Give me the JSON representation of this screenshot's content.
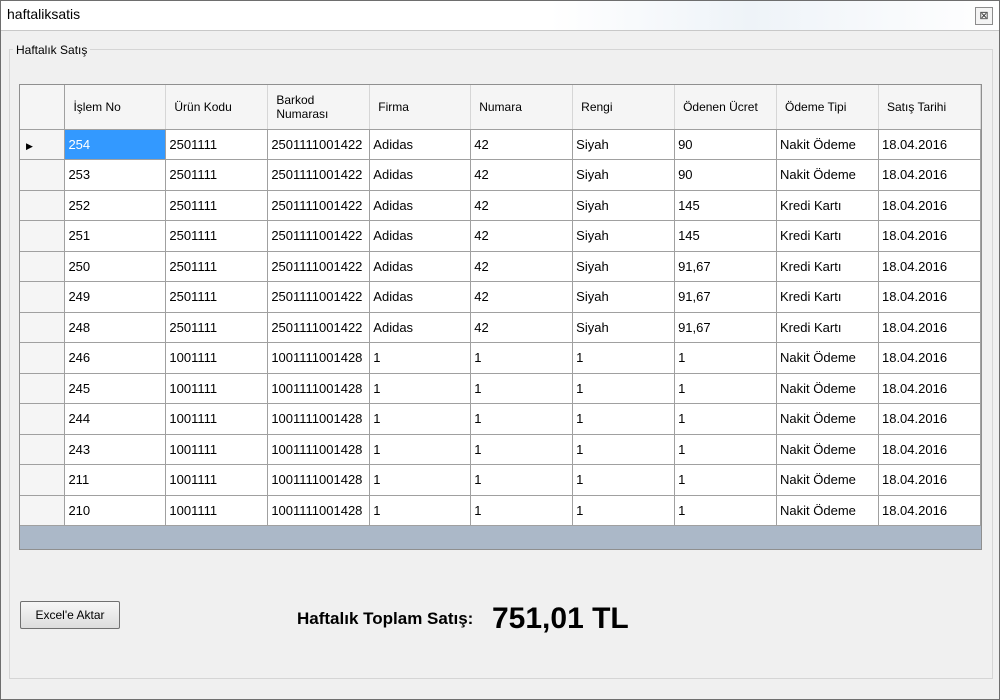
{
  "window": {
    "title": "haftaliksatis",
    "close_glyph": "⊠"
  },
  "group": {
    "title": "Haftalık Satış"
  },
  "grid": {
    "columns": [
      "İşlem No",
      "Ürün Kodu",
      "Barkod Numarası",
      "Firma",
      "Numara",
      "Rengi",
      "Ödenen Ücret",
      "Ödeme Tipi",
      "Satış Tarihi"
    ],
    "current_row_glyph": "▶",
    "selected_row": 0,
    "selected_col": 0,
    "rows": [
      [
        "254",
        "2501111",
        "2501111001422",
        "Adidas",
        "42",
        "Siyah",
        "90",
        "Nakit Ödeme",
        "18.04.2016"
      ],
      [
        "253",
        "2501111",
        "2501111001422",
        "Adidas",
        "42",
        "Siyah",
        "90",
        "Nakit Ödeme",
        "18.04.2016"
      ],
      [
        "252",
        "2501111",
        "2501111001422",
        "Adidas",
        "42",
        "Siyah",
        "145",
        "Kredi Kartı",
        "18.04.2016"
      ],
      [
        "251",
        "2501111",
        "2501111001422",
        "Adidas",
        "42",
        "Siyah",
        "145",
        "Kredi Kartı",
        "18.04.2016"
      ],
      [
        "250",
        "2501111",
        "2501111001422",
        "Adidas",
        "42",
        "Siyah",
        "91,67",
        "Kredi Kartı",
        "18.04.2016"
      ],
      [
        "249",
        "2501111",
        "2501111001422",
        "Adidas",
        "42",
        "Siyah",
        "91,67",
        "Kredi Kartı",
        "18.04.2016"
      ],
      [
        "248",
        "2501111",
        "2501111001422",
        "Adidas",
        "42",
        "Siyah",
        "91,67",
        "Kredi Kartı",
        "18.04.2016"
      ],
      [
        "246",
        "1001111",
        "1001111001428",
        "1",
        "1",
        "1",
        "1",
        "Nakit Ödeme",
        "18.04.2016"
      ],
      [
        "245",
        "1001111",
        "1001111001428",
        "1",
        "1",
        "1",
        "1",
        "Nakit Ödeme",
        "18.04.2016"
      ],
      [
        "244",
        "1001111",
        "1001111001428",
        "1",
        "1",
        "1",
        "1",
        "Nakit Ödeme",
        "18.04.2016"
      ],
      [
        "243",
        "1001111",
        "1001111001428",
        "1",
        "1",
        "1",
        "1",
        "Nakit Ödeme",
        "18.04.2016"
      ],
      [
        "211",
        "1001111",
        "1001111001428",
        "1",
        "1",
        "1",
        "1",
        "Nakit Ödeme",
        "18.04.2016"
      ],
      [
        "210",
        "1001111",
        "1001111001428",
        "1",
        "1",
        "1",
        "1",
        "Nakit Ödeme",
        "18.04.2016"
      ]
    ]
  },
  "actions": {
    "excel_label": "Excel'e Aktar"
  },
  "summary": {
    "label": "Haftalık Toplam Satış:",
    "value": "751,01 TL"
  }
}
